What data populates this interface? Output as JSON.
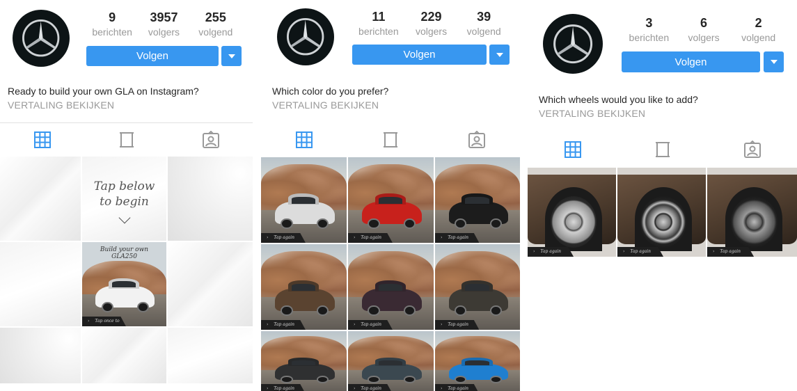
{
  "panels": [
    {
      "stats": [
        {
          "num": "9",
          "label": "berichten"
        },
        {
          "num": "3957",
          "label": "volgers"
        },
        {
          "num": "255",
          "label": "volgend"
        }
      ],
      "follow_label": "Volgen",
      "bio": "Ready to build your own GLA on Instagram?",
      "translation_label": "VERTALING BEKIJKEN",
      "prompt_line1": "Tap below",
      "prompt_line2": "to begin",
      "promo_title_line1": "Build your own",
      "promo_title_line2": "GLA250",
      "promo_strip": "Tap once to begin"
    },
    {
      "stats": [
        {
          "num": "11",
          "label": "berichten"
        },
        {
          "num": "229",
          "label": "volgers"
        },
        {
          "num": "39",
          "label": "volgend"
        }
      ],
      "follow_label": "Volgen",
      "bio": "Which color do you prefer?",
      "translation_label": "VERTALING BEKIJKEN",
      "strip_label": "Tap again",
      "car_colors": [
        "#dcdcdc",
        "#c8211c",
        "#1c1c1c",
        "#5a4330",
        "#3a2a33",
        "#3d3a34",
        "#2f3031",
        "#3b4850",
        "#1f7fd0"
      ]
    },
    {
      "stats": [
        {
          "num": "3",
          "label": "berichten"
        },
        {
          "num": "6",
          "label": "volgers"
        },
        {
          "num": "2",
          "label": "volgend"
        }
      ],
      "follow_label": "Volgen",
      "bio": "Which wheels would you like to add?",
      "translation_label": "VERTALING BEKIJKEN",
      "strip_label": "Tap again"
    }
  ],
  "colors": {
    "accent": "#3897f0",
    "active_tab": "#3897f0",
    "inactive_tab": "#999999"
  },
  "tab_icons": [
    "grid-icon",
    "list-icon",
    "tagged-photos-icon"
  ]
}
